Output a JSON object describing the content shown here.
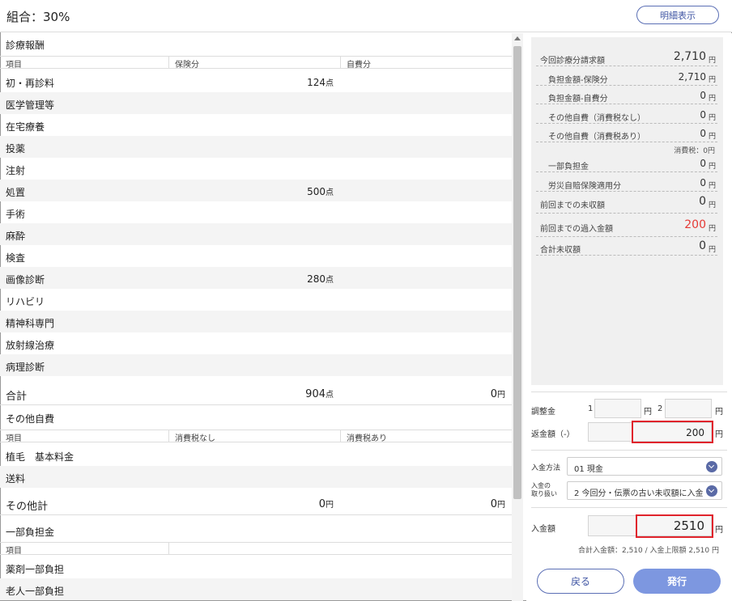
{
  "header": {
    "title": "組合：30%",
    "detail_button": "明細表示"
  },
  "medical": {
    "section_title": "診療報酬",
    "columns": [
      "項目",
      "保険分",
      "自費分"
    ],
    "rows": [
      {
        "label": "初・再診料",
        "insured": "124",
        "unit": "点",
        "self": ""
      },
      {
        "label": "医学管理等",
        "insured": "",
        "unit": "",
        "self": ""
      },
      {
        "label": "在宅療養",
        "insured": "",
        "unit": "",
        "self": ""
      },
      {
        "label": "投薬",
        "insured": "",
        "unit": "",
        "self": ""
      },
      {
        "label": "注射",
        "insured": "",
        "unit": "",
        "self": ""
      },
      {
        "label": "処置",
        "insured": "500",
        "unit": "点",
        "self": ""
      },
      {
        "label": "手術",
        "insured": "",
        "unit": "",
        "self": ""
      },
      {
        "label": "麻酔",
        "insured": "",
        "unit": "",
        "self": ""
      },
      {
        "label": "検査",
        "insured": "",
        "unit": "",
        "self": ""
      },
      {
        "label": "画像診断",
        "insured": "280",
        "unit": "点",
        "self": ""
      },
      {
        "label": "リハビリ",
        "insured": "",
        "unit": "",
        "self": ""
      },
      {
        "label": "精神科専門",
        "insured": "",
        "unit": "",
        "self": ""
      },
      {
        "label": "放射線治療",
        "insured": "",
        "unit": "",
        "self": ""
      },
      {
        "label": "病理診断",
        "insured": "",
        "unit": "",
        "self": ""
      }
    ],
    "total": {
      "label": "合計",
      "insured": "904",
      "insured_unit": "点",
      "self": "0",
      "self_unit": "円"
    }
  },
  "other_self": {
    "section_title": "その他自費",
    "columns": [
      "項目",
      "消費税なし",
      "消費税あり"
    ],
    "rows": [
      {
        "label": "植毛　基本料金"
      },
      {
        "label": "送料"
      }
    ],
    "total": {
      "label": "その他計",
      "no_tax": "0",
      "with_tax": "0",
      "unit": "円"
    }
  },
  "partial": {
    "section_title": "一部負担金",
    "columns": [
      "項目",
      ""
    ],
    "rows": [
      {
        "label": "薬剤一部負担"
      },
      {
        "label": "老人一部負担"
      }
    ]
  },
  "summary": {
    "rows": [
      {
        "label": "今回診療分請求額",
        "value": "2,710",
        "unit": "円"
      },
      {
        "label": "負担金額-保険分",
        "value": "2,710",
        "unit": "円"
      },
      {
        "label": "負担金額-自費分",
        "value": "0",
        "unit": "円"
      },
      {
        "label": "その他自費（消費税なし）",
        "value": "0",
        "unit": "円"
      },
      {
        "label": "その他自費（消費税あり）",
        "value": "0",
        "unit": "円"
      },
      {
        "label": "一部負担金",
        "value": "0",
        "unit": "円"
      },
      {
        "label": "労災自賠保険適用分",
        "value": "0",
        "unit": "円"
      },
      {
        "label": "前回までの未収額",
        "value": "0",
        "unit": "円"
      },
      {
        "label": "前回までの過入金額",
        "value": "200",
        "unit": "円"
      },
      {
        "label": "合計未収額",
        "value": "0",
        "unit": "円"
      }
    ],
    "tax_note": "消費税：0円"
  },
  "adjust": {
    "label": "調整金",
    "num1": "1",
    "num2": "2",
    "unit": "円"
  },
  "refund": {
    "label": "返金額（-）",
    "value": "200",
    "unit": "円"
  },
  "payment_method": {
    "label": "入金方法",
    "value": "01 現金"
  },
  "payment_handling": {
    "label_line1": "入金の",
    "label_line2": "取り扱い",
    "value": "2 今回分・伝票の古い未収額に入金"
  },
  "deposit": {
    "label": "入金額",
    "value": "2510",
    "unit": "円"
  },
  "deposit_note": "合計入金額：2,510 / 入金上限額 2,510 円",
  "buttons": {
    "back": "戻る",
    "issue": "発行"
  },
  "colors": {
    "accent": "#5b6fb5",
    "primary_button": "#7d97e0",
    "highlight_red": "#e0242c",
    "negative_value": "#e53935"
  }
}
